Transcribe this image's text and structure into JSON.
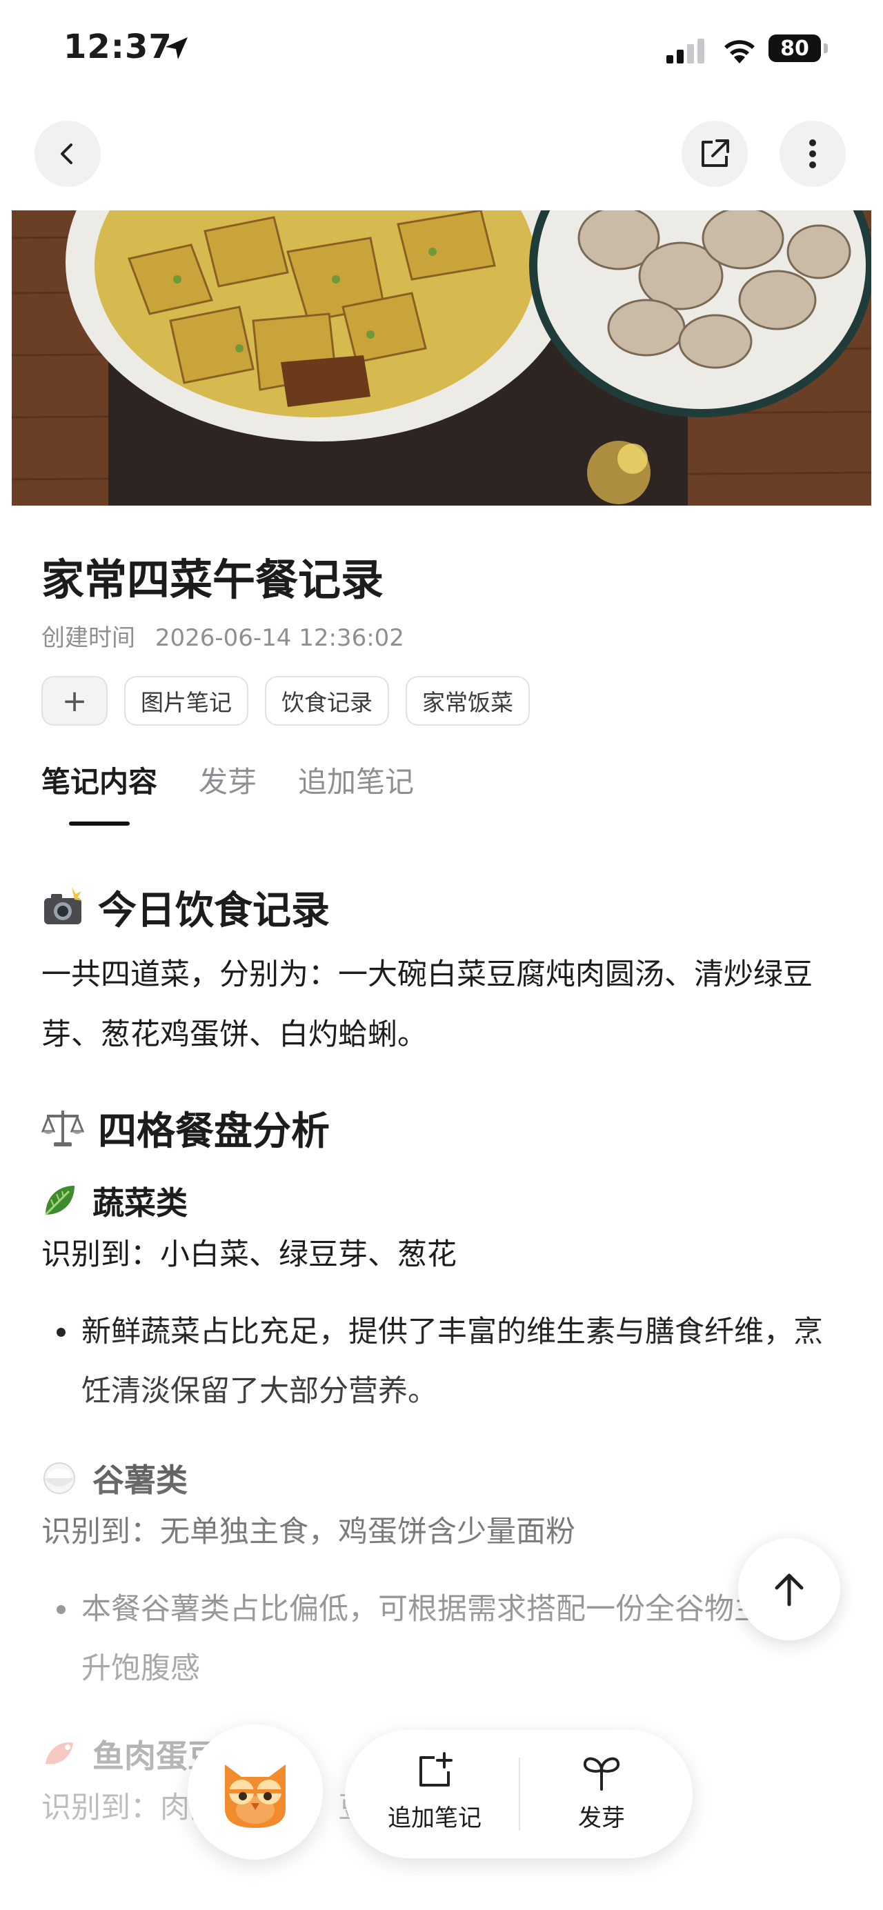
{
  "status_bar": {
    "time": "12:37",
    "battery": "80"
  },
  "note": {
    "title": "家常四菜午餐记录",
    "created_label": "创建时间",
    "created_time": "2026-06-14 12:36:02",
    "tags": [
      "图片笔记",
      "饮食记录",
      "家常饭菜"
    ],
    "add_tag_label": "+"
  },
  "tabs": [
    {
      "label": "笔记内容",
      "active": true
    },
    {
      "label": "发芽",
      "active": false
    },
    {
      "label": "追加笔记",
      "active": false
    }
  ],
  "content": {
    "section1": {
      "icon": "camera-flash-emoji",
      "heading": "今日饮食记录",
      "text": "一共四道菜，分别为：一大碗白菜豆腐炖肉圆汤、清炒绿豆芽、葱花鸡蛋饼、白灼蛤蜊。"
    },
    "section2": {
      "icon": "balance-scale-emoji",
      "heading": "四格餐盘分析",
      "groups": [
        {
          "icon": "leafy-green-emoji",
          "title": "蔬菜类",
          "identified": "识别到：小白菜、绿豆芽、葱花",
          "bullet": "新鲜蔬菜占比充足，提供了丰富的维生素与膳食纤维，烹饪清淡保留了大部分营养。"
        },
        {
          "icon": "rice-emoji",
          "title": "谷薯类",
          "identified": "识别到：无单独主食，鸡蛋饼含少量面粉",
          "bullet": "本餐谷薯类占比偏低，可根据需求搭配一份全谷物主食提升饱腹感"
        },
        {
          "icon": "fish-meat-egg-emoji",
          "title": "鱼肉蛋豆",
          "identified": "识别到：肉圆、鸡蛋、豆腐、蛤蜊"
        }
      ]
    }
  },
  "bottom_bar": {
    "add_note_label": "追加笔记",
    "sprout_label": "发芽"
  },
  "colors": {
    "text": "#1c1c1e",
    "secondary": "#8e8e93",
    "accent_underline": "#111111",
    "table_wood": "#6a3f26"
  }
}
